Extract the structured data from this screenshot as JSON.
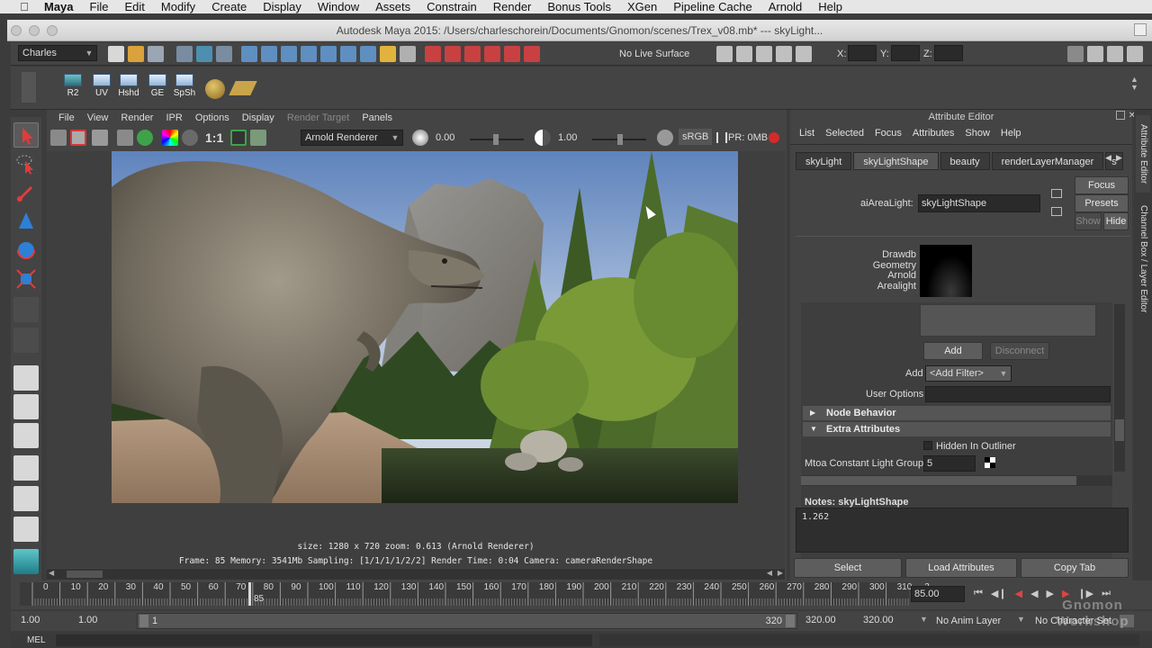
{
  "mac_menu": {
    "app_name": "Maya",
    "items": [
      "File",
      "Edit",
      "Modify",
      "Create",
      "Display",
      "Window",
      "Assets",
      "Constrain",
      "Render",
      "Bonus Tools",
      "XGen",
      "Pipeline Cache",
      "Arnold",
      "Help"
    ]
  },
  "window": {
    "title": "Autodesk Maya 2015: /Users/charleschorein/Documents/Gnomon/scenes/Trex_v08.mb*   ---   skyLight..."
  },
  "status_line": {
    "menu_set": "Charles",
    "live_surface": "No Live Surface",
    "x_label": "X:",
    "y_label": "Y:",
    "z_label": "Z:"
  },
  "shelf": {
    "items": [
      "R2",
      "UV",
      "Hshd",
      "GE",
      "SpSh"
    ]
  },
  "render_view": {
    "menu": [
      "File",
      "View",
      "Render",
      "IPR",
      "Options",
      "Display",
      "Render Target",
      "Panels"
    ],
    "ratio_label": "1:1",
    "renderer": "Arnold Renderer",
    "exposure": "0.00",
    "gamma": "1.00",
    "color_space": "sRGB",
    "ipr_memory": "IPR: 0MB",
    "info_line1": "size: 1280 x 720 zoom: 0.613    (Arnold Renderer)",
    "info_line2": "Frame: 85    Memory: 3541Mb    Sampling: [1/1/1/1/2/2]    Render Time: 0:04    Camera: cameraRenderShape"
  },
  "attribute_editor": {
    "title": "Attribute Editor",
    "menu": [
      "List",
      "Selected",
      "Focus",
      "Attributes",
      "Show",
      "Help"
    ],
    "tabs": [
      "skyLight",
      "skyLightShape",
      "beauty",
      "renderLayerManager",
      "s"
    ],
    "active_tab": "skyLightShape",
    "node_type_label": "aiAreaLight:",
    "node_name": "skyLightShape",
    "focus_btn": "Focus",
    "presets_btn": "Presets",
    "show_btn": "Show",
    "hide_btn": "Hide",
    "swatch_label": "Drawdb Geometry Arnold Arealight",
    "add_btn": "Add",
    "disconnect_btn": "Disconnect",
    "add_label": "Add",
    "add_filter": "<Add Filter>",
    "user_options_label": "User Options",
    "section_node_behavior": "Node Behavior",
    "section_extra": "Extra Attributes",
    "hidden_in_outliner": "Hidden In Outliner",
    "light_group_label": "Mtoa Constant Light Group",
    "light_group_value": "5",
    "notes_label": "Notes:  skyLightShape",
    "notes_value": "1.262",
    "bottom_buttons": [
      "Select",
      "Load Attributes",
      "Copy Tab"
    ]
  },
  "side_tabs": [
    "Attribute Editor",
    "Channel Box / Layer Editor"
  ],
  "timeline": {
    "ticks": [
      "0",
      "10",
      "20",
      "30",
      "40",
      "50",
      "60",
      "70",
      "80",
      "90",
      "100",
      "110",
      "120",
      "130",
      "140",
      "150",
      "160",
      "170",
      "180",
      "190",
      "200",
      "210",
      "220",
      "230",
      "240",
      "250",
      "260",
      "270",
      "280",
      "290",
      "300",
      "310",
      "3"
    ],
    "current_frame_marker": "85",
    "current_frame_field": "85.00"
  },
  "range": {
    "start": "1.00",
    "playback_start": "1.00",
    "slider_start": "1",
    "slider_end": "320",
    "playback_end": "320.00",
    "end": "320.00",
    "anim_layer": "No Anim Layer",
    "char_set": "No Character Set"
  },
  "command_line": {
    "label": "MEL"
  },
  "watermark": "Gnomon Workshop",
  "colors": {
    "accent_red": "#cc2a2a",
    "panel_bg": "#444444",
    "field_bg": "#2a2a2a"
  }
}
